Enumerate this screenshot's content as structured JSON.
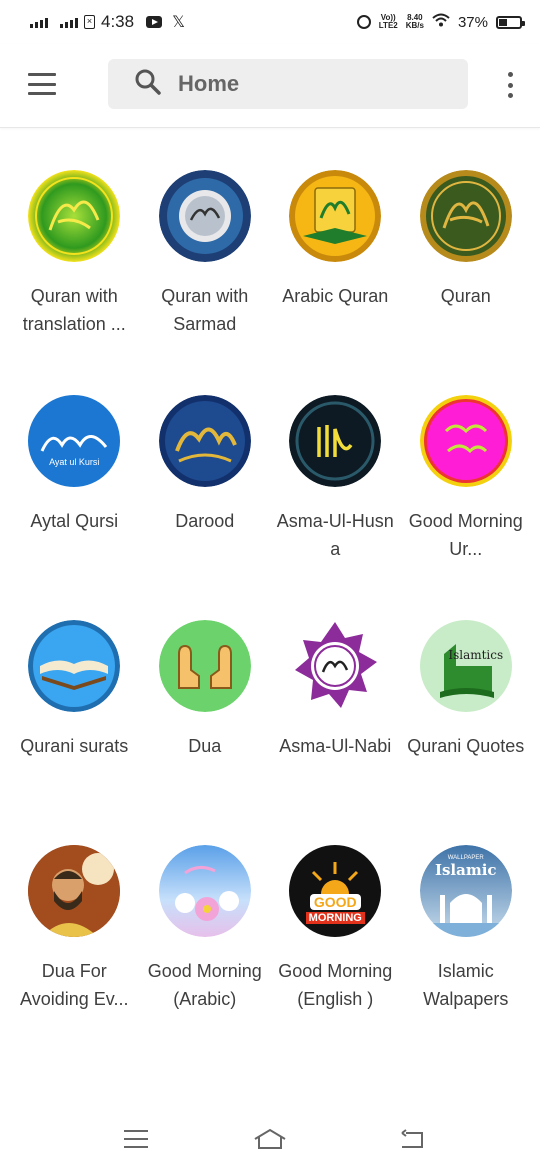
{
  "status_bar": {
    "time": "4:38",
    "lte_label": "LTE2",
    "volte_label": "Vo))",
    "speed_value": "8.40",
    "speed_unit": "KB/s",
    "battery_percent": "37%",
    "battery_level": 0.37
  },
  "header": {
    "title": "Home",
    "icons": {
      "menu": "hamburger-menu-icon",
      "search": "search-icon",
      "more": "kebab-menu-icon"
    }
  },
  "apps": [
    {
      "label": "Quran with translation ...",
      "icon": "quran-translation-icon",
      "colors": [
        "#2f9a1f",
        "#f4e21c"
      ]
    },
    {
      "label": "Quran with Sarmad",
      "icon": "quran-sarmad-icon",
      "colors": [
        "#1d3f75",
        "#e8e8ea"
      ]
    },
    {
      "label": "Arabic Quran",
      "icon": "arabic-quran-icon",
      "colors": [
        "#f6b715",
        "#1f7d2b"
      ]
    },
    {
      "label": "Quran",
      "icon": "quran-icon",
      "colors": [
        "#3a5a1e",
        "#e0b640"
      ]
    },
    {
      "label": "Aytal Qursi",
      "icon": "ayat-ul-kursi-icon",
      "colors": [
        "#1b77d2",
        "#ffffff"
      ],
      "badge_text": "Ayat ul Kursi"
    },
    {
      "label": "Darood",
      "icon": "darood-icon",
      "colors": [
        "#12306c",
        "#e3b83a"
      ]
    },
    {
      "label": "Asma-Ul-Husna",
      "icon": "asma-ul-husna-icon",
      "colors": [
        "#0d1a24",
        "#f2dd3b"
      ]
    },
    {
      "label": "Good Morning Ur...",
      "icon": "good-morning-urdu-icon",
      "colors": [
        "#ff1ed6",
        "#f4d10f"
      ]
    },
    {
      "label": "Qurani surats",
      "icon": "qurani-surats-icon",
      "colors": [
        "#3aa5f0",
        "#7a4a1c"
      ]
    },
    {
      "label": "Dua",
      "icon": "dua-hands-icon",
      "colors": [
        "#6cd36c",
        "#f5c26b"
      ]
    },
    {
      "label": "Asma-Ul-Nabi",
      "icon": "asma-ul-nabi-icon",
      "colors": [
        "#8c2b9a",
        "#ffffff"
      ]
    },
    {
      "label": "Qurani Quotes",
      "icon": "qurani-quotes-icon",
      "colors": [
        "#2e8b2e",
        "#ffffff"
      ],
      "badge_text": "Islamtics"
    },
    {
      "label": "Dua For Avoiding Ev...",
      "icon": "dua-avoiding-evil-icon",
      "colors": [
        "#a34d1f",
        "#f6e3c0"
      ]
    },
    {
      "label": "Good Morning(Arabic)",
      "icon": "good-morning-arabic-icon",
      "colors": [
        "#9bc8f5",
        "#f2a3d8"
      ]
    },
    {
      "label": "Good Morning(English )",
      "icon": "good-morning-english-icon",
      "colors": [
        "#111111",
        "#f5a71a"
      ],
      "badge_text": [
        "GOOD",
        "MORNING"
      ]
    },
    {
      "label": "Islamic Walpapers",
      "icon": "islamic-wallpapers-icon",
      "colors": [
        "#7fb0d9",
        "#ffffff"
      ],
      "badge_text": [
        "WALLPAPER",
        "Islamic"
      ]
    }
  ],
  "nav_bar": {
    "icons": [
      "recents-menu-icon",
      "home-icon",
      "back-icon"
    ]
  }
}
